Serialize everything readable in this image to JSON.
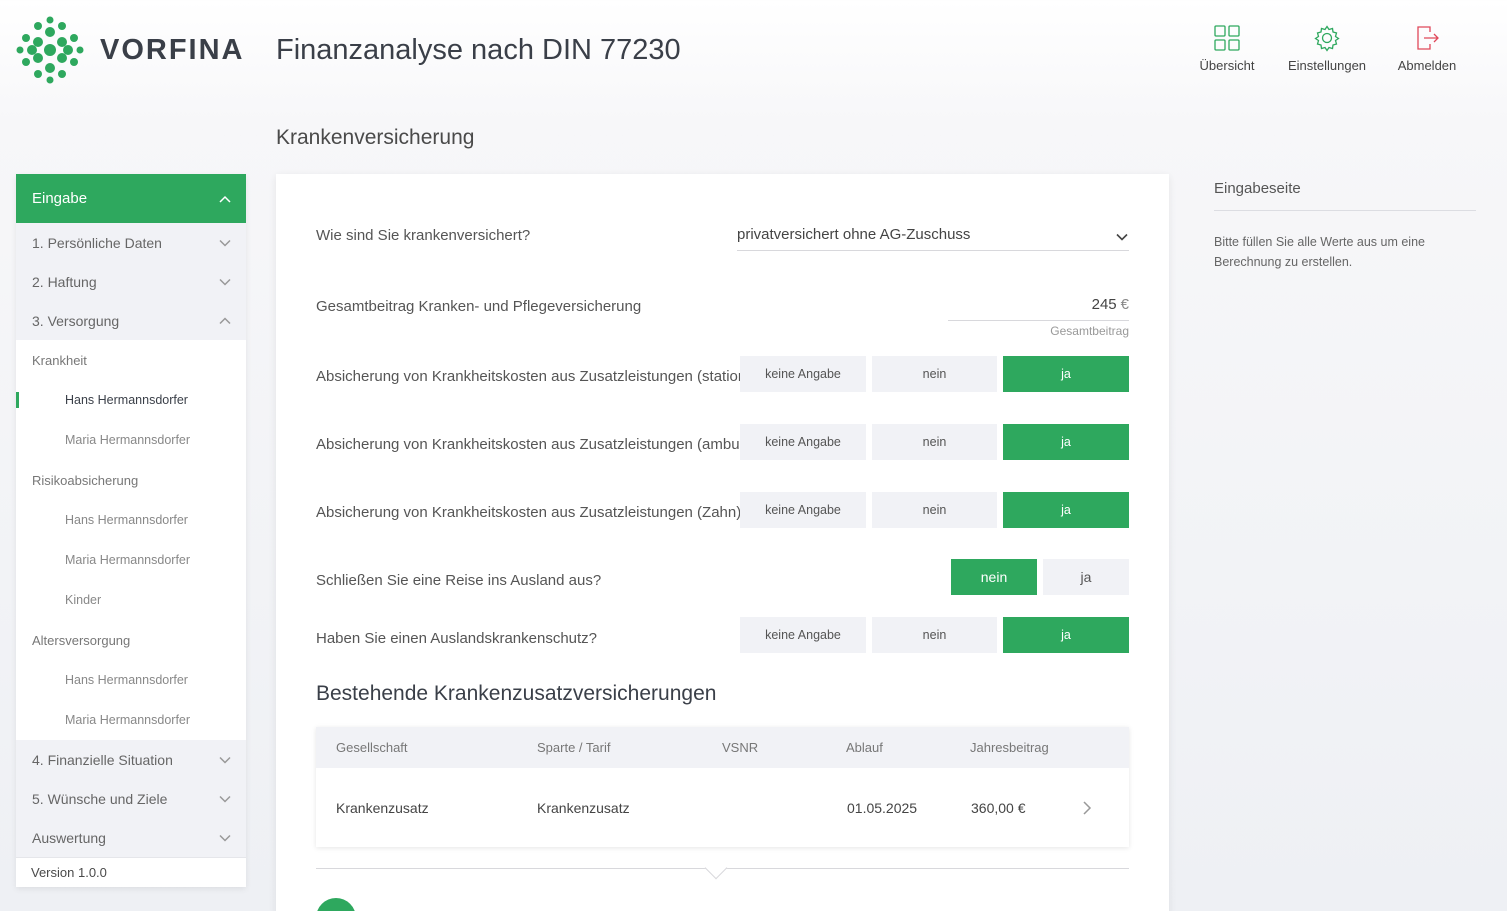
{
  "brand": {
    "name": "VORFINA",
    "accent": "#2ea85e"
  },
  "header": {
    "title": "Finanzanalyse nach DIN 77230",
    "nav": [
      {
        "label": "Übersicht",
        "icon": "grid-icon"
      },
      {
        "label": "Einstellungen",
        "icon": "gear-icon"
      },
      {
        "label": "Abmelden",
        "icon": "logout-icon"
      }
    ]
  },
  "page": {
    "title": "Krankenversicherung"
  },
  "sidebar": {
    "head": "Eingabe",
    "sections": [
      "1. Persönliche Daten",
      "2. Haftung",
      "3. Versorgung",
      "4. Finanzielle Situation",
      "5. Wünsche und Ziele",
      "Auswertung"
    ],
    "groups": [
      {
        "label": "Krankheit",
        "items": [
          "Hans Hermannsdorfer",
          "Maria Hermannsdorfer"
        ]
      },
      {
        "label": "Risikoabsicherung",
        "items": [
          "Hans Hermannsdorfer",
          "Maria Hermannsdorfer",
          "Kinder"
        ]
      },
      {
        "label": "Altersversorgung",
        "items": [
          "Hans Hermannsdorfer",
          "Maria Hermannsdorfer"
        ]
      }
    ],
    "version": "Version 1.0.0"
  },
  "form": {
    "q_insurance": "Wie sind Sie krankenversichert?",
    "insurance_value": "privatversichert ohne AG-Zuschuss",
    "q_total": "Gesamtbeitrag Kranken- und Pflegeversicherung",
    "total_value": "245",
    "total_unit": "€",
    "total_hint": "Gesamtbeitrag",
    "q_stationaer": "Absicherung von Krankheitskosten aus Zusatzleistungen (stationär)",
    "q_ambulant": "Absicherung von Krankheitskosten aus Zusatzleistungen (ambulant)",
    "q_zahn": "Absicherung von Krankheitskosten aus Zusatzleistungen (Zahn)",
    "q_reise": "Schließen Sie eine Reise ins Ausland aus?",
    "q_ausland": "Haben Sie einen Auslandskrankenschutz?",
    "opt_none": "keine Angabe",
    "opt_no": "nein",
    "opt_yes": "ja"
  },
  "table": {
    "title": "Bestehende Krankenzusatzversicherungen",
    "headers": [
      "Gesellschaft",
      "Sparte / Tarif",
      "VSNR",
      "Ablauf",
      "Jahresbeitrag"
    ],
    "rows": [
      {
        "gesellschaft": "Krankenzusatz",
        "sparte": "Krankenzusatz",
        "vsnr": "",
        "ablauf": "01.05.2025",
        "beitrag": "360,00 €"
      }
    ]
  },
  "info": {
    "title": "Eingabeseite",
    "text": "Bitte füllen Sie alle Werte aus um eine Berechnung zu erstellen."
  }
}
